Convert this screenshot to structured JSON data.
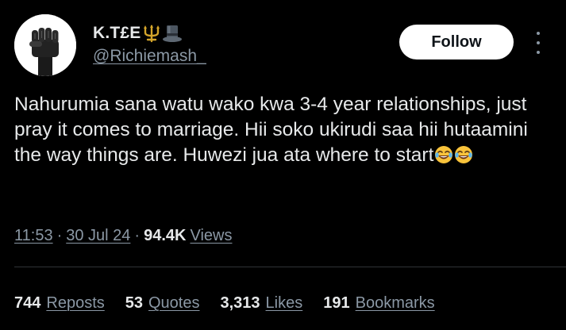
{
  "author": {
    "display_name": "K.T£E",
    "name_emojis": [
      "trident-emoji",
      "top-hat-emoji"
    ],
    "handle": "@Richiemash_"
  },
  "follow_label": "Follow",
  "tweet": {
    "text": "Nahurumia sana watu wako kwa 3-4 year relationships, just pray it comes to marriage. Hii soko ukirudi saa hii hutaamini the way things are. Huwezi jua ata where to start",
    "trailing_emojis": [
      "laughing-tears-emoji",
      "laughing-tears-emoji"
    ]
  },
  "meta": {
    "time": "11:53",
    "separator": "·",
    "date": "30 Jul 24",
    "views_count": "94.4K",
    "views_label": "Views"
  },
  "stats": [
    {
      "count": "744",
      "label": "Reposts"
    },
    {
      "count": "53",
      "label": "Quotes"
    },
    {
      "count": "3,313",
      "label": "Likes"
    },
    {
      "count": "191",
      "label": "Bookmarks"
    }
  ],
  "colors": {
    "background": "#000000",
    "primary_text": "#e7e9ea",
    "secondary_text": "#8b98a5",
    "divider": "#2f3336",
    "follow_bg": "#ffffff",
    "follow_text": "#0f1419"
  },
  "icons": {
    "more": "more-vertical-icon"
  }
}
